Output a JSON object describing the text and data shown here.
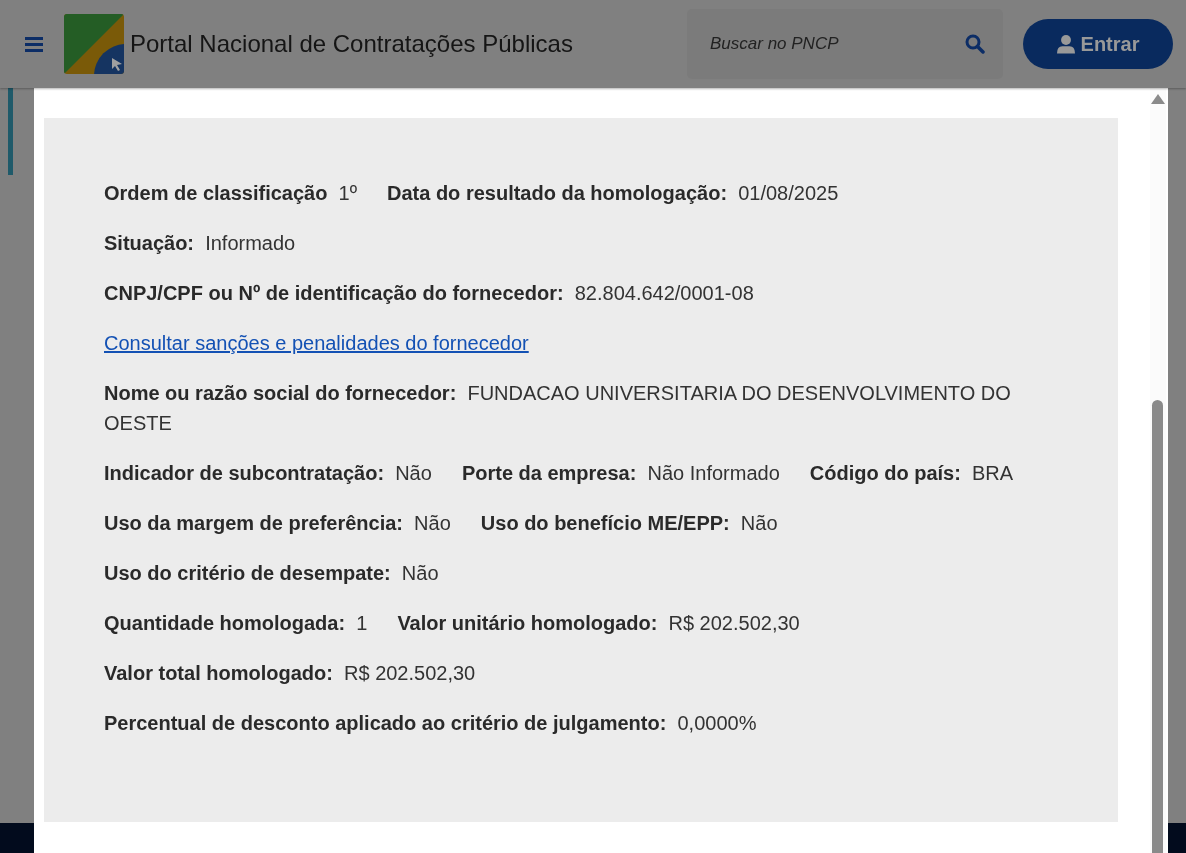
{
  "header": {
    "title": "Portal Nacional de Contratações Públicas",
    "search": {
      "placeholder": "Buscar no PNCP"
    },
    "login_button": "Entrar"
  },
  "modal": {
    "rows": [
      {
        "kind": "fields",
        "items": [
          {
            "label": "Ordem de classificação",
            "value": "1º"
          },
          {
            "label": "Data do resultado da homologação:",
            "value": "01/08/2025"
          }
        ]
      },
      {
        "kind": "fields",
        "items": [
          {
            "label": "Situação:",
            "value": "Informado"
          }
        ]
      },
      {
        "kind": "fields",
        "items": [
          {
            "label": "CNPJ/CPF ou Nº de identificação do fornecedor:",
            "value": "82.804.642/0001-08"
          }
        ]
      },
      {
        "kind": "link",
        "text": "Consultar sanções e penalidades do fornecedor"
      },
      {
        "kind": "fields",
        "items": [
          {
            "label": "Nome ou razão social do fornecedor:",
            "value": "FUNDACAO UNIVERSITARIA DO DESENVOLVIMENTO DO OESTE"
          }
        ]
      },
      {
        "kind": "fields",
        "items": [
          {
            "label": "Indicador de subcontratação:",
            "value": "Não"
          },
          {
            "label": "Porte da empresa:",
            "value": "Não Informado"
          },
          {
            "label": "Código do país:",
            "value": "BRA"
          }
        ]
      },
      {
        "kind": "fields",
        "items": [
          {
            "label": "Uso da margem de preferência:",
            "value": "Não"
          },
          {
            "label": "Uso do benefício ME/EPP:",
            "value": "Não"
          }
        ]
      },
      {
        "kind": "fields",
        "items": [
          {
            "label": "Uso do critério de desempate:",
            "value": "Não"
          }
        ]
      },
      {
        "kind": "fields",
        "items": [
          {
            "label": "Quantidade homologada:",
            "value": "1"
          },
          {
            "label": "Valor unitário homologado:",
            "value": "R$ 202.502,30"
          }
        ]
      },
      {
        "kind": "fields",
        "items": [
          {
            "label": "Valor total homologado:",
            "value": "R$ 202.502,30"
          }
        ]
      },
      {
        "kind": "fields",
        "items": [
          {
            "label": "Percentual de desconto aplicado ao critério de julgamento:",
            "value": "0,0000%"
          }
        ]
      }
    ]
  }
}
